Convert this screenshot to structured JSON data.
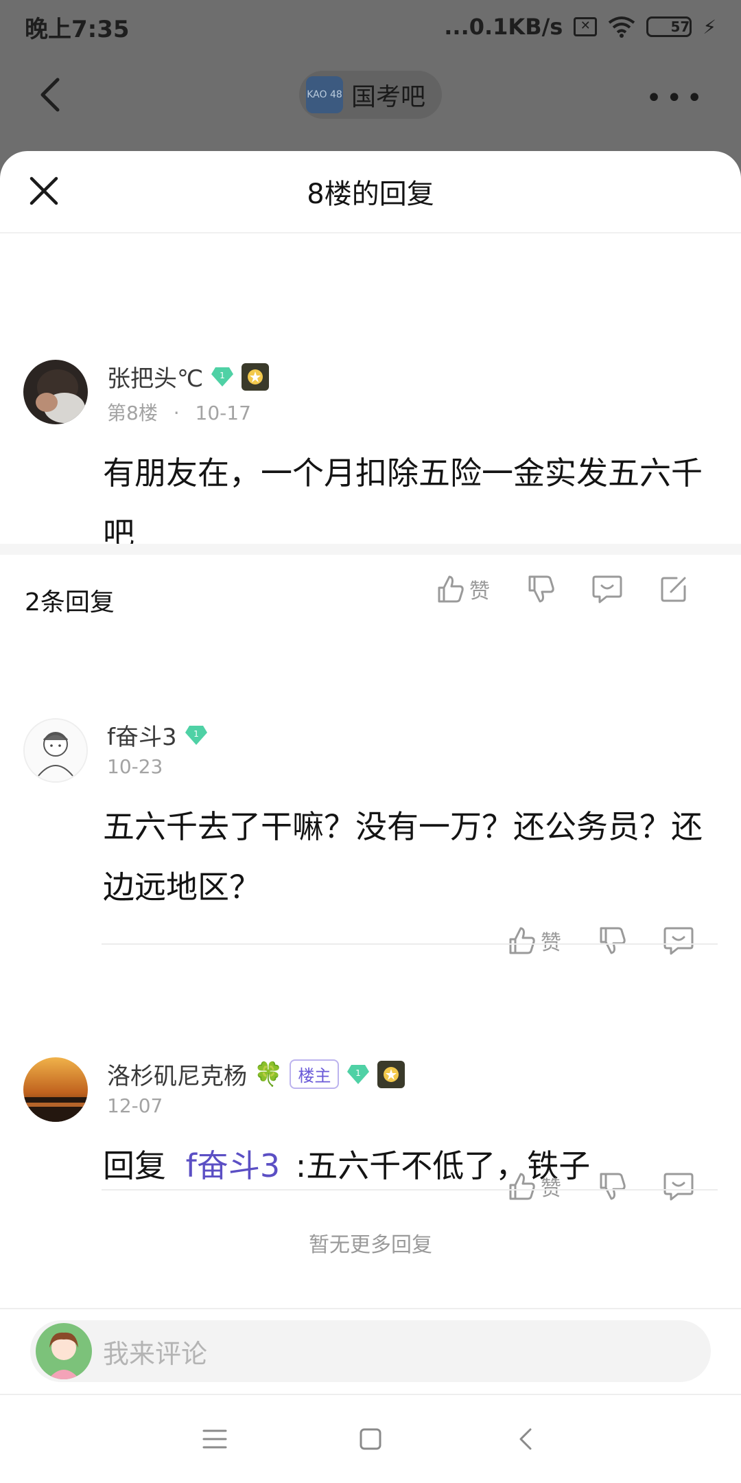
{
  "status_bar": {
    "time": "晚上7:35",
    "network_speed": "...0.1KB/s",
    "battery_level": "57"
  },
  "background_nav": {
    "forum_name": "国考吧",
    "forum_logo_text": "KAO 48"
  },
  "sheet": {
    "title": "8楼的回复"
  },
  "main_post": {
    "username": "张把头℃",
    "level": "1",
    "floor": "第8楼",
    "separator": "·",
    "date": "10-17",
    "content": "有朋友在，一个月扣除五险一金实发五六千吧",
    "like_label": "赞"
  },
  "replies_header": {
    "count_label": "2条回复"
  },
  "replies": [
    {
      "username": "f奋斗3",
      "level": "1",
      "date": "10-23",
      "content": "五六千去了干嘛？没有一万？还公务员？还边远地区？",
      "like_label": "赞"
    },
    {
      "username": "洛杉矶尼克杨",
      "user_emoji": "🍀",
      "owner_tag": "楼主",
      "level": "1",
      "date": "12-07",
      "reply_prefix": "回复",
      "mention": "f奋斗3",
      "content": " :五六千不低了，铁子",
      "like_label": "赞"
    }
  ],
  "no_more_label": "暂无更多回复",
  "comment_bar": {
    "placeholder": "我来评论"
  },
  "colors": {
    "accent": "#5b4fc4",
    "gem": "#4fd1a5",
    "gray_text": "#a3a3a3"
  }
}
